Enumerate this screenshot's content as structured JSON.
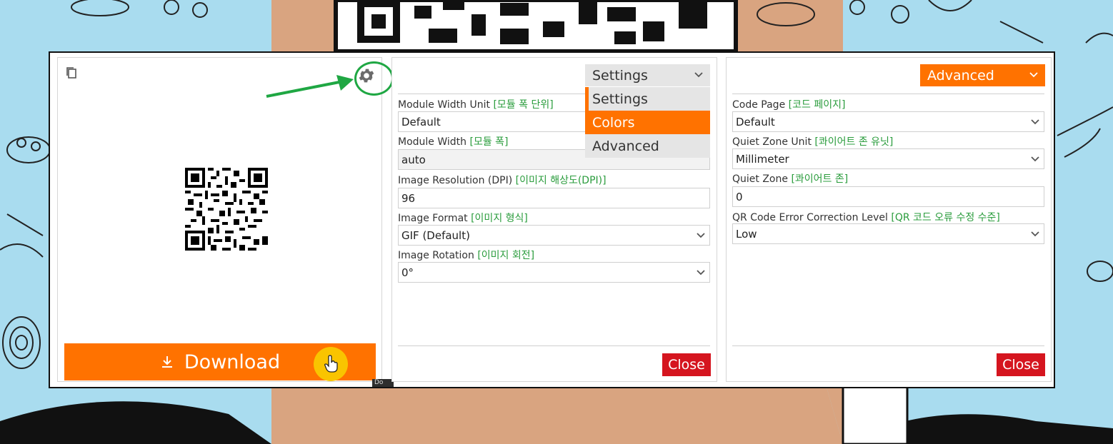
{
  "theme": {
    "accent": "#ff7200",
    "danger": "#d5151f",
    "korean_hint": "#2a9c3c",
    "highlight": "#1fa743"
  },
  "preview": {
    "download_label": "Download",
    "tooltip_text": "Do"
  },
  "settings_panel": {
    "selected": "Settings",
    "menu": [
      "Settings",
      "Colors",
      "Advanced"
    ],
    "fields": [
      {
        "label": "Module Width Unit",
        "label_ko": "[모듈 폭 단위]",
        "value": "Default"
      },
      {
        "label": "Module Width",
        "label_ko": "[모듈 폭]",
        "value": "auto"
      },
      {
        "label": "Image Resolution (DPI)",
        "label_ko": "[이미지 해상도(DPI)]",
        "value": "96"
      },
      {
        "label": "Image Format",
        "label_ko": "[이미지 형식]",
        "value": "GIF (Default)"
      },
      {
        "label": "Image Rotation",
        "label_ko": "[이미지 회전]",
        "value": "0°"
      }
    ],
    "close_label": "Close"
  },
  "advanced_panel": {
    "selected": "Advanced",
    "fields": [
      {
        "label": "Code Page",
        "label_ko": "[코드 페이지]",
        "value": "Default"
      },
      {
        "label": "Quiet Zone Unit",
        "label_ko": "[콰이어트 존 유닛]",
        "value": "Millimeter"
      },
      {
        "label": "Quiet Zone",
        "label_ko": "[콰이어트 존]",
        "value": "0"
      },
      {
        "label": "QR Code Error Correction Level",
        "label_ko": "[QR 코드 오류 수정 수준]",
        "value": "Low"
      }
    ],
    "close_label": "Close"
  }
}
